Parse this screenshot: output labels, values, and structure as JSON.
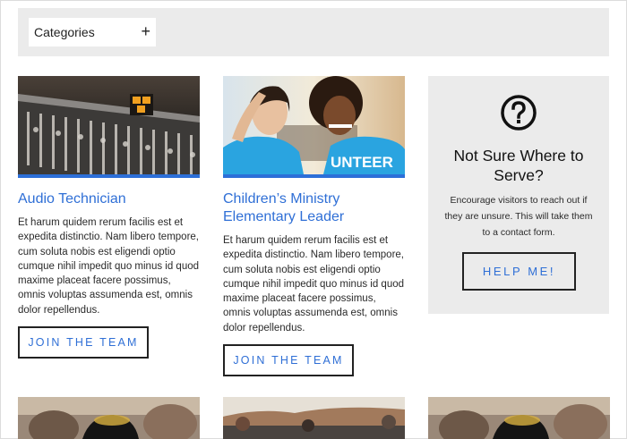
{
  "filter": {
    "categories_label": "Categories",
    "expand_icon": "plus-icon"
  },
  "cards": [
    {
      "image": "audio-mixing-console",
      "title": "Audio Technician",
      "description": "Et harum quidem rerum facilis est et expedita distinctio. Nam libero tempore, cum soluta nobis est eligendi optio cumque nihil impedit quo minus id quod maxime placeat facere possimus, omnis voluptas assumenda est, omnis dolor repellendus.",
      "button_label": "JOIN THE TEAM"
    },
    {
      "image": "volunteers-selfie",
      "image_text": "UNTEER",
      "title": "Children’s Ministry Elementary Leader",
      "description": "Et harum quidem rerum facilis est et expedita distinctio. Nam libero tempore, cum soluta nobis est eligendi optio cumque nihil impedit quo minus id quod maxime placeat facere possimus, omnis voluptas assumenda est, omnis dolor repellendus.",
      "button_label": "JOIN THE TEAM"
    }
  ],
  "help": {
    "icon": "question-circle-icon",
    "title": "Not Sure Where to Serve?",
    "description": "Encourage visitors to reach out if they are unsure. This will take them to a contact form.",
    "button_label": "HELP ME!"
  },
  "bottom_images": [
    "crowd-with-cap",
    "group-outdoors-canyon",
    "crowd-with-cap"
  ],
  "colors": {
    "accent": "#2f6fd6",
    "panel": "#ebebeb",
    "border": "#222222"
  }
}
